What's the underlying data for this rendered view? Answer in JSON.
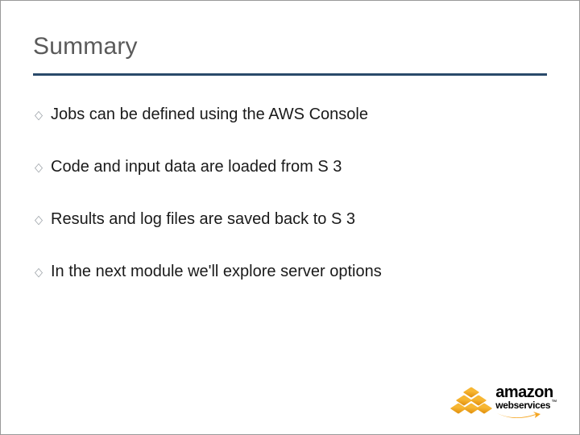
{
  "title": "Summary",
  "bullets": [
    "Jobs can be defined using the AWS Console",
    "Code and input data are loaded from S 3",
    "Results and log files are saved back to S 3",
    "In the next module we'll explore server options"
  ],
  "logo": {
    "brand": "amazon",
    "sub": "webservices",
    "tm": "™"
  }
}
